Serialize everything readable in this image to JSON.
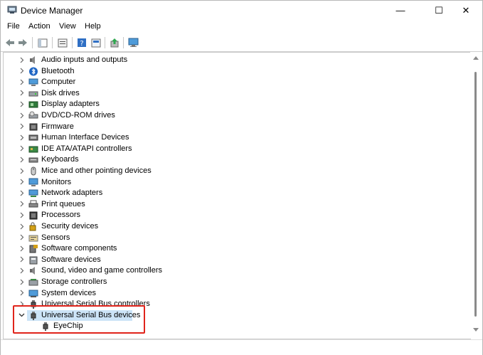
{
  "window": {
    "title": "Device Manager"
  },
  "title_controls": {
    "minimize": "—",
    "maximize": "☐",
    "close": "✕"
  },
  "menu": [
    "File",
    "Action",
    "View",
    "Help"
  ],
  "toolbar": {
    "buttons": [
      "back-arrow-icon",
      "forward-arrow-icon",
      "show-hide-console-tree-icon",
      "properties-icon",
      "help-icon",
      "scan-hardware-icon",
      "update-driver-icon",
      "monitor-icon"
    ]
  },
  "tree": {
    "items": [
      {
        "label": "Audio inputs and outputs",
        "icon": "speaker-icon",
        "state": "collapsed"
      },
      {
        "label": "Bluetooth",
        "icon": "bluetooth-icon",
        "state": "collapsed"
      },
      {
        "label": "Computer",
        "icon": "computer-icon",
        "state": "collapsed"
      },
      {
        "label": "Disk drives",
        "icon": "disk-drive-icon",
        "state": "collapsed"
      },
      {
        "label": "Display adapters",
        "icon": "display-adapter-icon",
        "state": "collapsed"
      },
      {
        "label": "DVD/CD-ROM drives",
        "icon": "dvd-drive-icon",
        "state": "collapsed"
      },
      {
        "label": "Firmware",
        "icon": "firmware-icon",
        "state": "collapsed"
      },
      {
        "label": "Human Interface Devices",
        "icon": "hid-icon",
        "state": "collapsed"
      },
      {
        "label": "IDE ATA/ATAPI controllers",
        "icon": "ide-controller-icon",
        "state": "collapsed"
      },
      {
        "label": "Keyboards",
        "icon": "keyboard-icon",
        "state": "collapsed"
      },
      {
        "label": "Mice and other pointing devices",
        "icon": "mouse-icon",
        "state": "collapsed"
      },
      {
        "label": "Monitors",
        "icon": "monitor-icon",
        "state": "collapsed"
      },
      {
        "label": "Network adapters",
        "icon": "network-adapter-icon",
        "state": "collapsed"
      },
      {
        "label": "Print queues",
        "icon": "printer-icon",
        "state": "collapsed"
      },
      {
        "label": "Processors",
        "icon": "processor-icon",
        "state": "collapsed"
      },
      {
        "label": "Security devices",
        "icon": "security-icon",
        "state": "collapsed"
      },
      {
        "label": "Sensors",
        "icon": "sensor-icon",
        "state": "collapsed"
      },
      {
        "label": "Software components",
        "icon": "software-component-icon",
        "state": "collapsed"
      },
      {
        "label": "Software devices",
        "icon": "software-device-icon",
        "state": "collapsed"
      },
      {
        "label": "Sound, video and game controllers",
        "icon": "sound-icon",
        "state": "collapsed"
      },
      {
        "label": "Storage controllers",
        "icon": "storage-controller-icon",
        "state": "collapsed"
      },
      {
        "label": "System devices",
        "icon": "system-device-icon",
        "state": "collapsed"
      },
      {
        "label": "Universal Serial Bus controllers",
        "icon": "usb-icon",
        "state": "collapsed"
      },
      {
        "label": "Universal Serial Bus devices",
        "icon": "usb-icon",
        "state": "expanded",
        "selected": true
      },
      {
        "label": "EyeChip",
        "icon": "usb-icon",
        "state": "leaf",
        "indent": 1
      }
    ]
  },
  "colors": {
    "selection": "#cce4f7",
    "highlight_box": "#e0241b",
    "accent": "#0078d4"
  }
}
